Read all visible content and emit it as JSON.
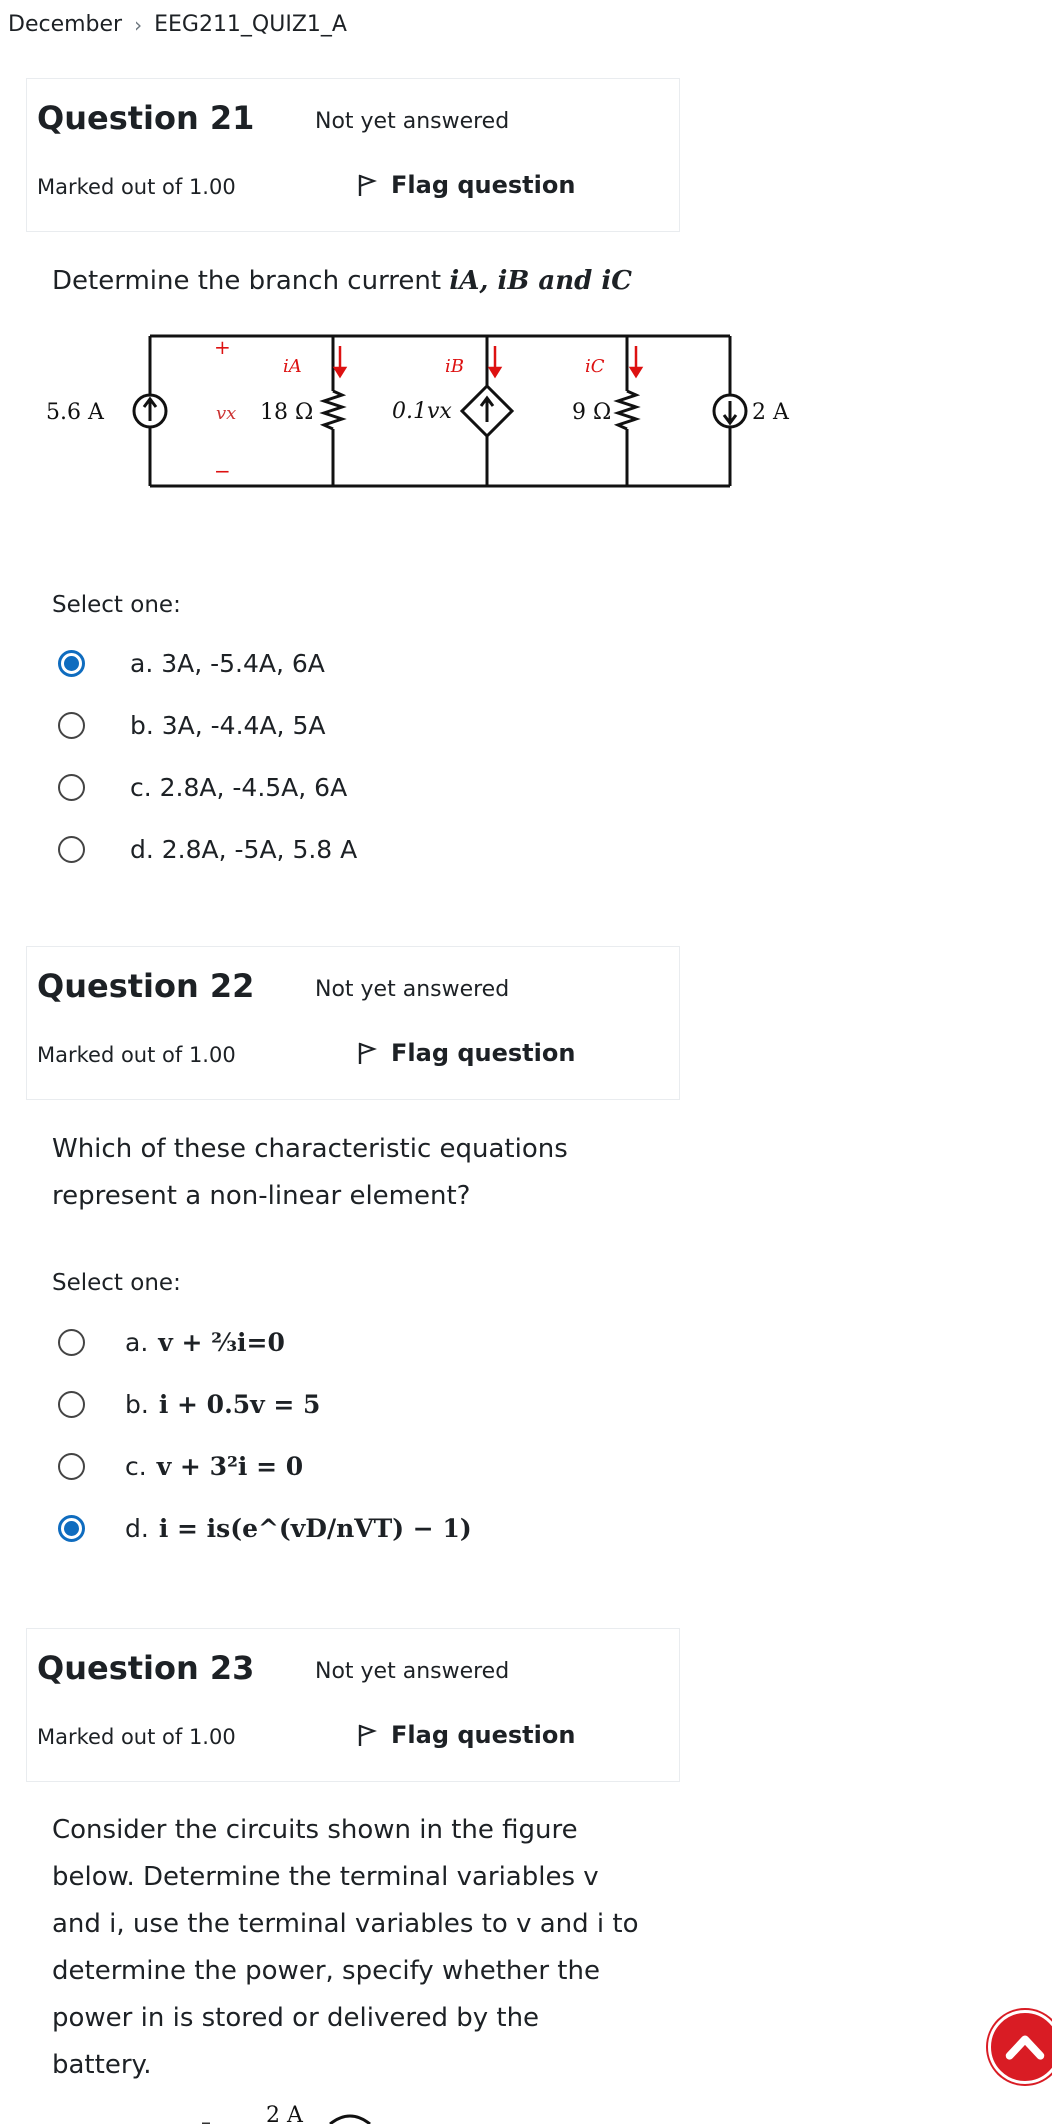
{
  "breadcrumb": {
    "items": [
      "December",
      "EEG211_QUIZ1_A"
    ]
  },
  "questions": [
    {
      "number_label": "Question 21",
      "state": "Not yet answered",
      "grade": "Marked out of 1.00",
      "flag_label": "Flag question",
      "text": "Determine the branch current ",
      "text_math": "iA, iB and iC",
      "circuit": {
        "source_left": "5.6 A",
        "plus": "+",
        "minus": "−",
        "vx": "vx",
        "r1": "18 Ω",
        "dep_source": "0.1vx",
        "r2": "9 Ω",
        "source_right": "2 A",
        "iA": "iA",
        "iB": "iB",
        "iC": "iC"
      },
      "select_one": "Select one:",
      "options": [
        {
          "label": "a. 3A, -5.4A, 6A",
          "selected": true
        },
        {
          "label": "b. 3A, -4.4A, 5A",
          "selected": false
        },
        {
          "label": "c. 2.8A, -4.5A, 6A",
          "selected": false
        },
        {
          "label": "d. 2.8A, -5A, 5.8 A",
          "selected": false
        }
      ]
    },
    {
      "number_label": "Question 22",
      "state": "Not yet answered",
      "grade": "Marked out of 1.00",
      "flag_label": "Flag question",
      "text_line1": "Which of these characteristic equations",
      "text_line2": "represent a non-linear element?",
      "select_one": "Select one:",
      "options": [
        {
          "prefix": "a.",
          "math": "v + ⅔i=0",
          "selected": false
        },
        {
          "prefix": "b.",
          "math": "i + 0.5v = 5",
          "selected": false
        },
        {
          "prefix": "c.",
          "math": "v + 3²i = 0",
          "selected": false
        },
        {
          "prefix": "d.",
          "math": "i = is(e^(vD/nVT) − 1)",
          "selected": true
        }
      ]
    },
    {
      "number_label": "Question 23",
      "state": "Not yet answered",
      "grade": "Marked out of 1.00",
      "flag_label": "Flag question",
      "text_lines": [
        "Consider the circuits shown in the figure",
        "below. Determine the terminal variables v",
        "and i, use the terminal variables to v and i to",
        "determine the power, specify whether the",
        "power in is stored or delivered by the",
        "battery."
      ],
      "figure_label": "2 A"
    }
  ],
  "colors": {
    "accent": "#0f6cbf",
    "back_to_top": "#d91c24"
  },
  "icons": {
    "flag": "flag-icon",
    "breadcrumb_separator": "chevron-right-icon",
    "back_to_top": "chevron-up-icon"
  }
}
